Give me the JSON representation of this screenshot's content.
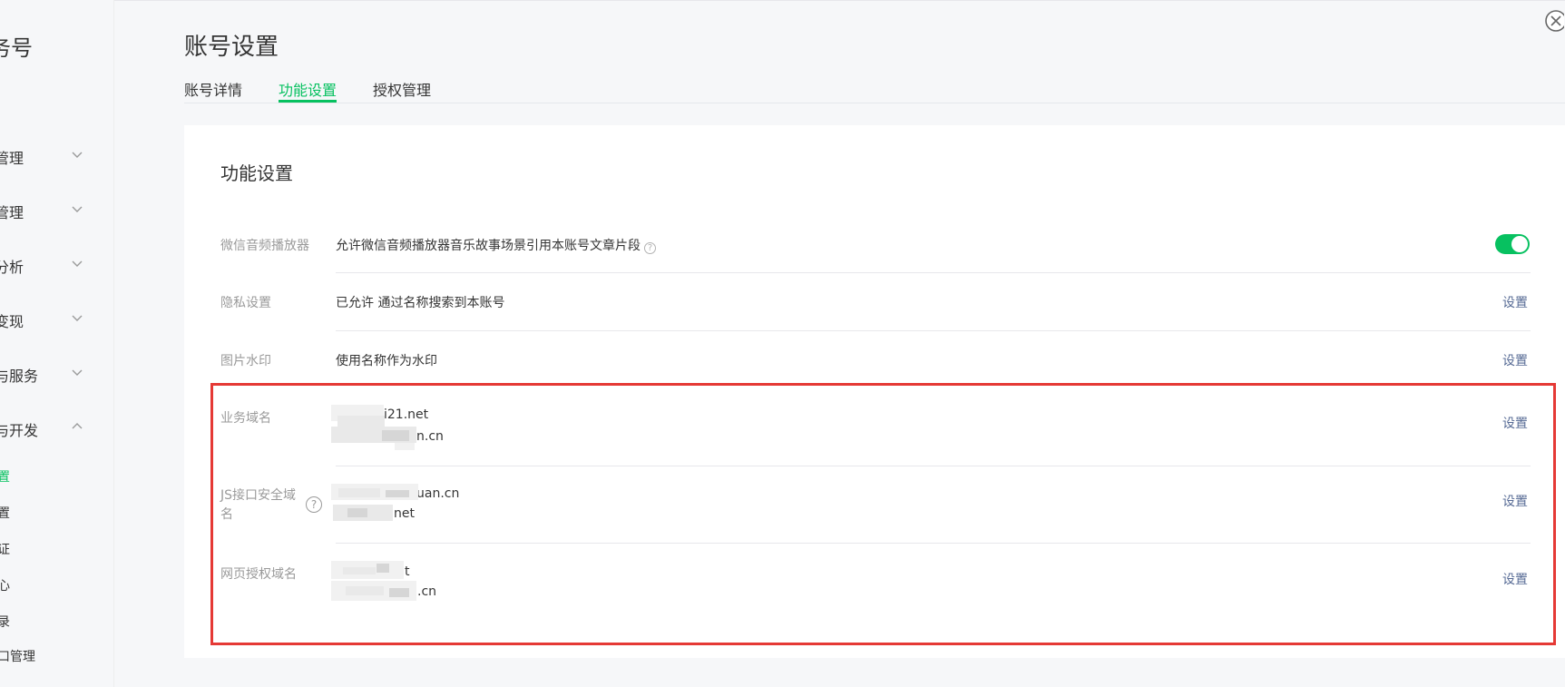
{
  "sidebar": {
    "brand": "务号",
    "groups": [
      {
        "label": "管理",
        "expanded": false
      },
      {
        "label": "管理",
        "expanded": false
      },
      {
        "label": "分析",
        "expanded": false
      },
      {
        "label": "变现",
        "expanded": false
      },
      {
        "label": "与服务",
        "expanded": false
      },
      {
        "label": "与开发",
        "expanded": true
      }
    ],
    "subitems": [
      {
        "label": "置",
        "active": true
      },
      {
        "label": "置",
        "active": false
      },
      {
        "label": "证",
        "active": false
      },
      {
        "label": "心",
        "active": false
      },
      {
        "label": "录",
        "active": false
      },
      {
        "label": "口管理",
        "active": false
      }
    ]
  },
  "header": {
    "title": "账号设置",
    "tabs": [
      {
        "label": "账号详情",
        "active": false
      },
      {
        "label": "功能设置",
        "active": true
      },
      {
        "label": "授权管理",
        "active": false
      }
    ]
  },
  "card": {
    "title": "功能设置",
    "rows": {
      "audio": {
        "label": "微信音频播放器",
        "value": "允许微信音频播放器音乐故事场景引用本账号文章片段",
        "toggle_on": true
      },
      "privacy": {
        "label": "隐私设置",
        "value": "已允许 通过名称搜索到本账号",
        "action": "设置"
      },
      "watermark": {
        "label": "图片水印",
        "value": "使用名称作为水印",
        "action": "设置"
      },
      "business_domain": {
        "label": "业务域名",
        "line1_visible": "i21.net",
        "line2_visible": "n.cn",
        "action": "设置"
      },
      "js_domain": {
        "label_line1": "JS接口安全域",
        "label_line2": "名",
        "line1_visible": "uan.cn",
        "line2_visible": "net",
        "action": "设置"
      },
      "oauth_domain": {
        "label": "网页授权域名",
        "line1_visible": "t",
        "line2_visible": ".cn",
        "action": "设置"
      }
    }
  },
  "colors": {
    "accent": "#07c160",
    "link": "#576b95",
    "highlight": "#e53935"
  }
}
